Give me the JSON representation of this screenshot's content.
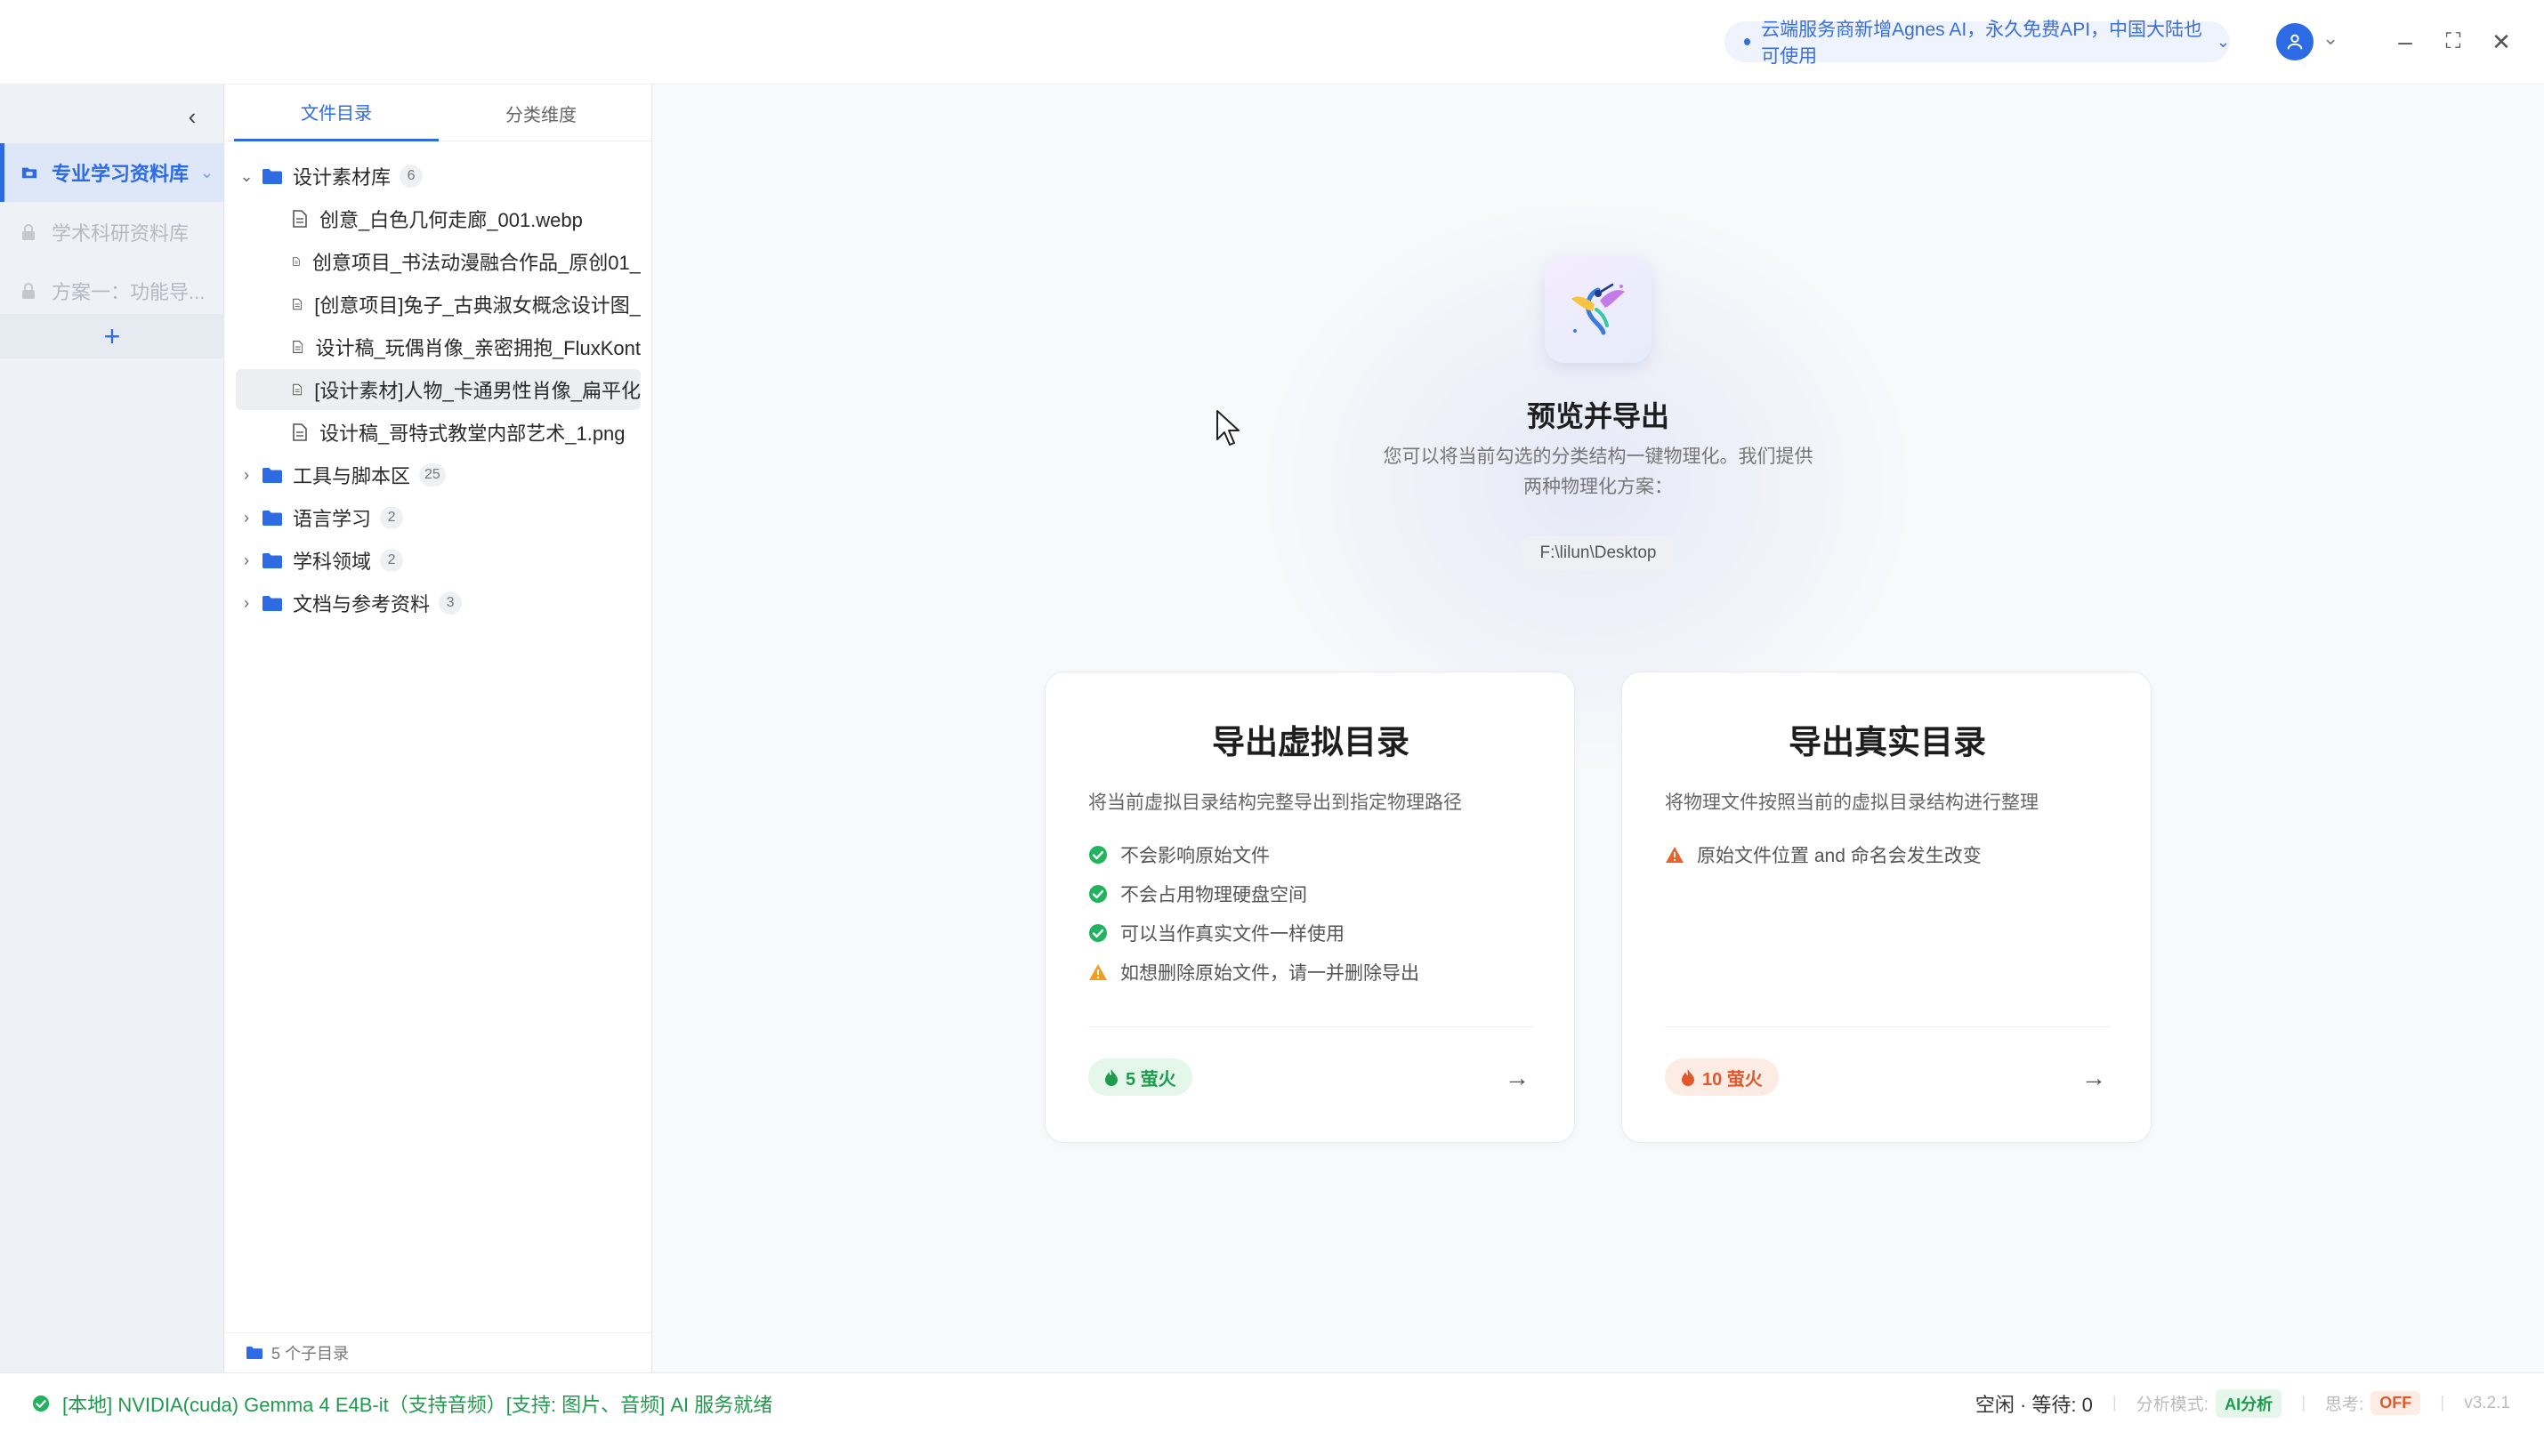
{
  "titlebar": {
    "notice": "云端服务商新增Agnes AI，永久免费API，中国大陆也可使用",
    "minimize": "–",
    "maximize": "⛶",
    "close": "✕"
  },
  "libraries": [
    {
      "label": "专业学习资料库",
      "state": "active"
    },
    {
      "label": "学术科研资料库",
      "state": "locked"
    },
    {
      "label": "方案一：功能导...",
      "state": "locked"
    }
  ],
  "rail": {
    "add": "+",
    "collapse": "‹"
  },
  "tabs": [
    {
      "label": "文件目录",
      "active": true
    },
    {
      "label": "分类维度",
      "active": false
    }
  ],
  "tree": [
    {
      "type": "folder",
      "label": "设计素材库",
      "count": "6",
      "expanded": true
    },
    {
      "type": "file",
      "label": "创意_白色几何走廊_001.webp"
    },
    {
      "type": "file",
      "label": "创意项目_书法动漫融合作品_原创01_"
    },
    {
      "type": "file",
      "label": "[创意项目]兔子_古典淑女概念设计图_"
    },
    {
      "type": "file",
      "label": "设计稿_玩偶肖像_亲密拥抱_FluxKont"
    },
    {
      "type": "file",
      "label": "[设计素材]人物_卡通男性肖像_扁平化",
      "selected": true
    },
    {
      "type": "file",
      "label": "设计稿_哥特式教堂内部艺术_1.png"
    },
    {
      "type": "folder",
      "label": "工具与脚本区",
      "count": "25"
    },
    {
      "type": "folder",
      "label": "语言学习",
      "count": "2"
    },
    {
      "type": "folder",
      "label": "学科领域",
      "count": "2"
    },
    {
      "type": "folder",
      "label": "文档与参考资料",
      "count": "3"
    }
  ],
  "tree_footer": "5 个子目录",
  "main": {
    "title": "预览并导出",
    "description": "您可以将当前勾选的分类结构一键物理化。我们提供两种物理化方案：",
    "path": "F:\\lilun\\Desktop"
  },
  "cards": [
    {
      "title": "导出虚拟目录",
      "description": "将当前虚拟目录结构完整导出到指定物理路径",
      "bullets": [
        {
          "kind": "check",
          "text": "不会影响原始文件"
        },
        {
          "kind": "check",
          "text": "不会占用物理硬盘空间"
        },
        {
          "kind": "check",
          "text": "可以当作真实文件一样使用"
        },
        {
          "kind": "warn",
          "text": "如想删除原始文件，请一并删除导出"
        }
      ],
      "cost": "5 萤火",
      "cost_color": "green"
    },
    {
      "title": "导出真实目录",
      "description": "将物理文件按照当前的虚拟目录结构进行整理",
      "bullets": [
        {
          "kind": "warn",
          "text": "原始文件位置 and 命名会发生改变"
        }
      ],
      "cost": "10 萤火",
      "cost_color": "orange"
    }
  ],
  "status": {
    "service": "[本地] NVIDIA(cuda) Gemma 4 E4B-it（支持音频）[支持: 图片、音频] AI 服务就绪",
    "queue": "空闲 · 等待: 0",
    "mode_label": "分析模式:",
    "mode_value": "AI分析",
    "think_label": "思考:",
    "think_value": "OFF",
    "version": "v3.2.1"
  },
  "colors": {
    "accent": "#2d6be4",
    "success": "#1f9b4d",
    "warning": "#f0a020",
    "danger": "#e0582c"
  }
}
